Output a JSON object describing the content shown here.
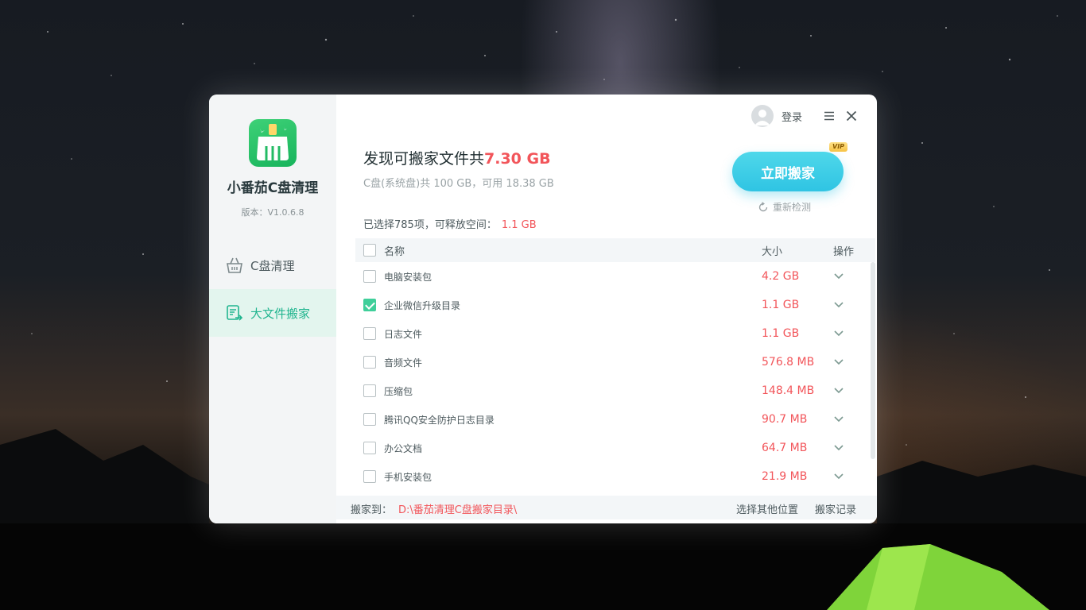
{
  "sidebar": {
    "app_name": "小番茄C盘清理",
    "version": "版本：V1.0.6.8",
    "nav": [
      {
        "label": "C盘清理",
        "icon": "basket-icon",
        "active": false
      },
      {
        "label": "大文件搬家",
        "icon": "file-move-icon",
        "active": true
      }
    ]
  },
  "topbar": {
    "login_label": "登录",
    "icons": [
      "avatar-icon",
      "menu-icon",
      "close-icon"
    ]
  },
  "summary": {
    "headline_prefix": "发现可搬家文件共",
    "headline_total": "7.30 GB",
    "disk_info": "C盘(系统盘)共 100 GB，可用 18.38 GB",
    "selection_text": "已选择785项，可释放空间：",
    "selection_free": "1.1 GB"
  },
  "actions": {
    "move_now": "立即搬家",
    "vip": "VIP",
    "recheck": "重新检测"
  },
  "table": {
    "headers": {
      "name": "名称",
      "size": "大小",
      "action": "操作"
    },
    "rows": [
      {
        "name": "电脑安装包",
        "size": "4.2 GB",
        "checked": false
      },
      {
        "name": "企业微信升级目录",
        "size": "1.1 GB",
        "checked": true
      },
      {
        "name": "日志文件",
        "size": "1.1 GB",
        "checked": false
      },
      {
        "name": "音频文件",
        "size": "576.8 MB",
        "checked": false
      },
      {
        "name": "压缩包",
        "size": "148.4 MB",
        "checked": false
      },
      {
        "name": "腾讯QQ安全防护日志目录",
        "size": "90.7 MB",
        "checked": false
      },
      {
        "name": "办公文档",
        "size": "64.7 MB",
        "checked": false
      },
      {
        "name": "手机安装包",
        "size": "21.9 MB",
        "checked": false
      }
    ]
  },
  "footer": {
    "dest_label": "搬家到：",
    "dest_path": "D:\\番茄清理C盘搬家目录\\",
    "other_location": "选择其他位置",
    "history": "搬家记录"
  },
  "colors": {
    "accent_green": "#21b58f",
    "accent_red": "#f2555a",
    "button_cyan": "#2fc4e3"
  }
}
